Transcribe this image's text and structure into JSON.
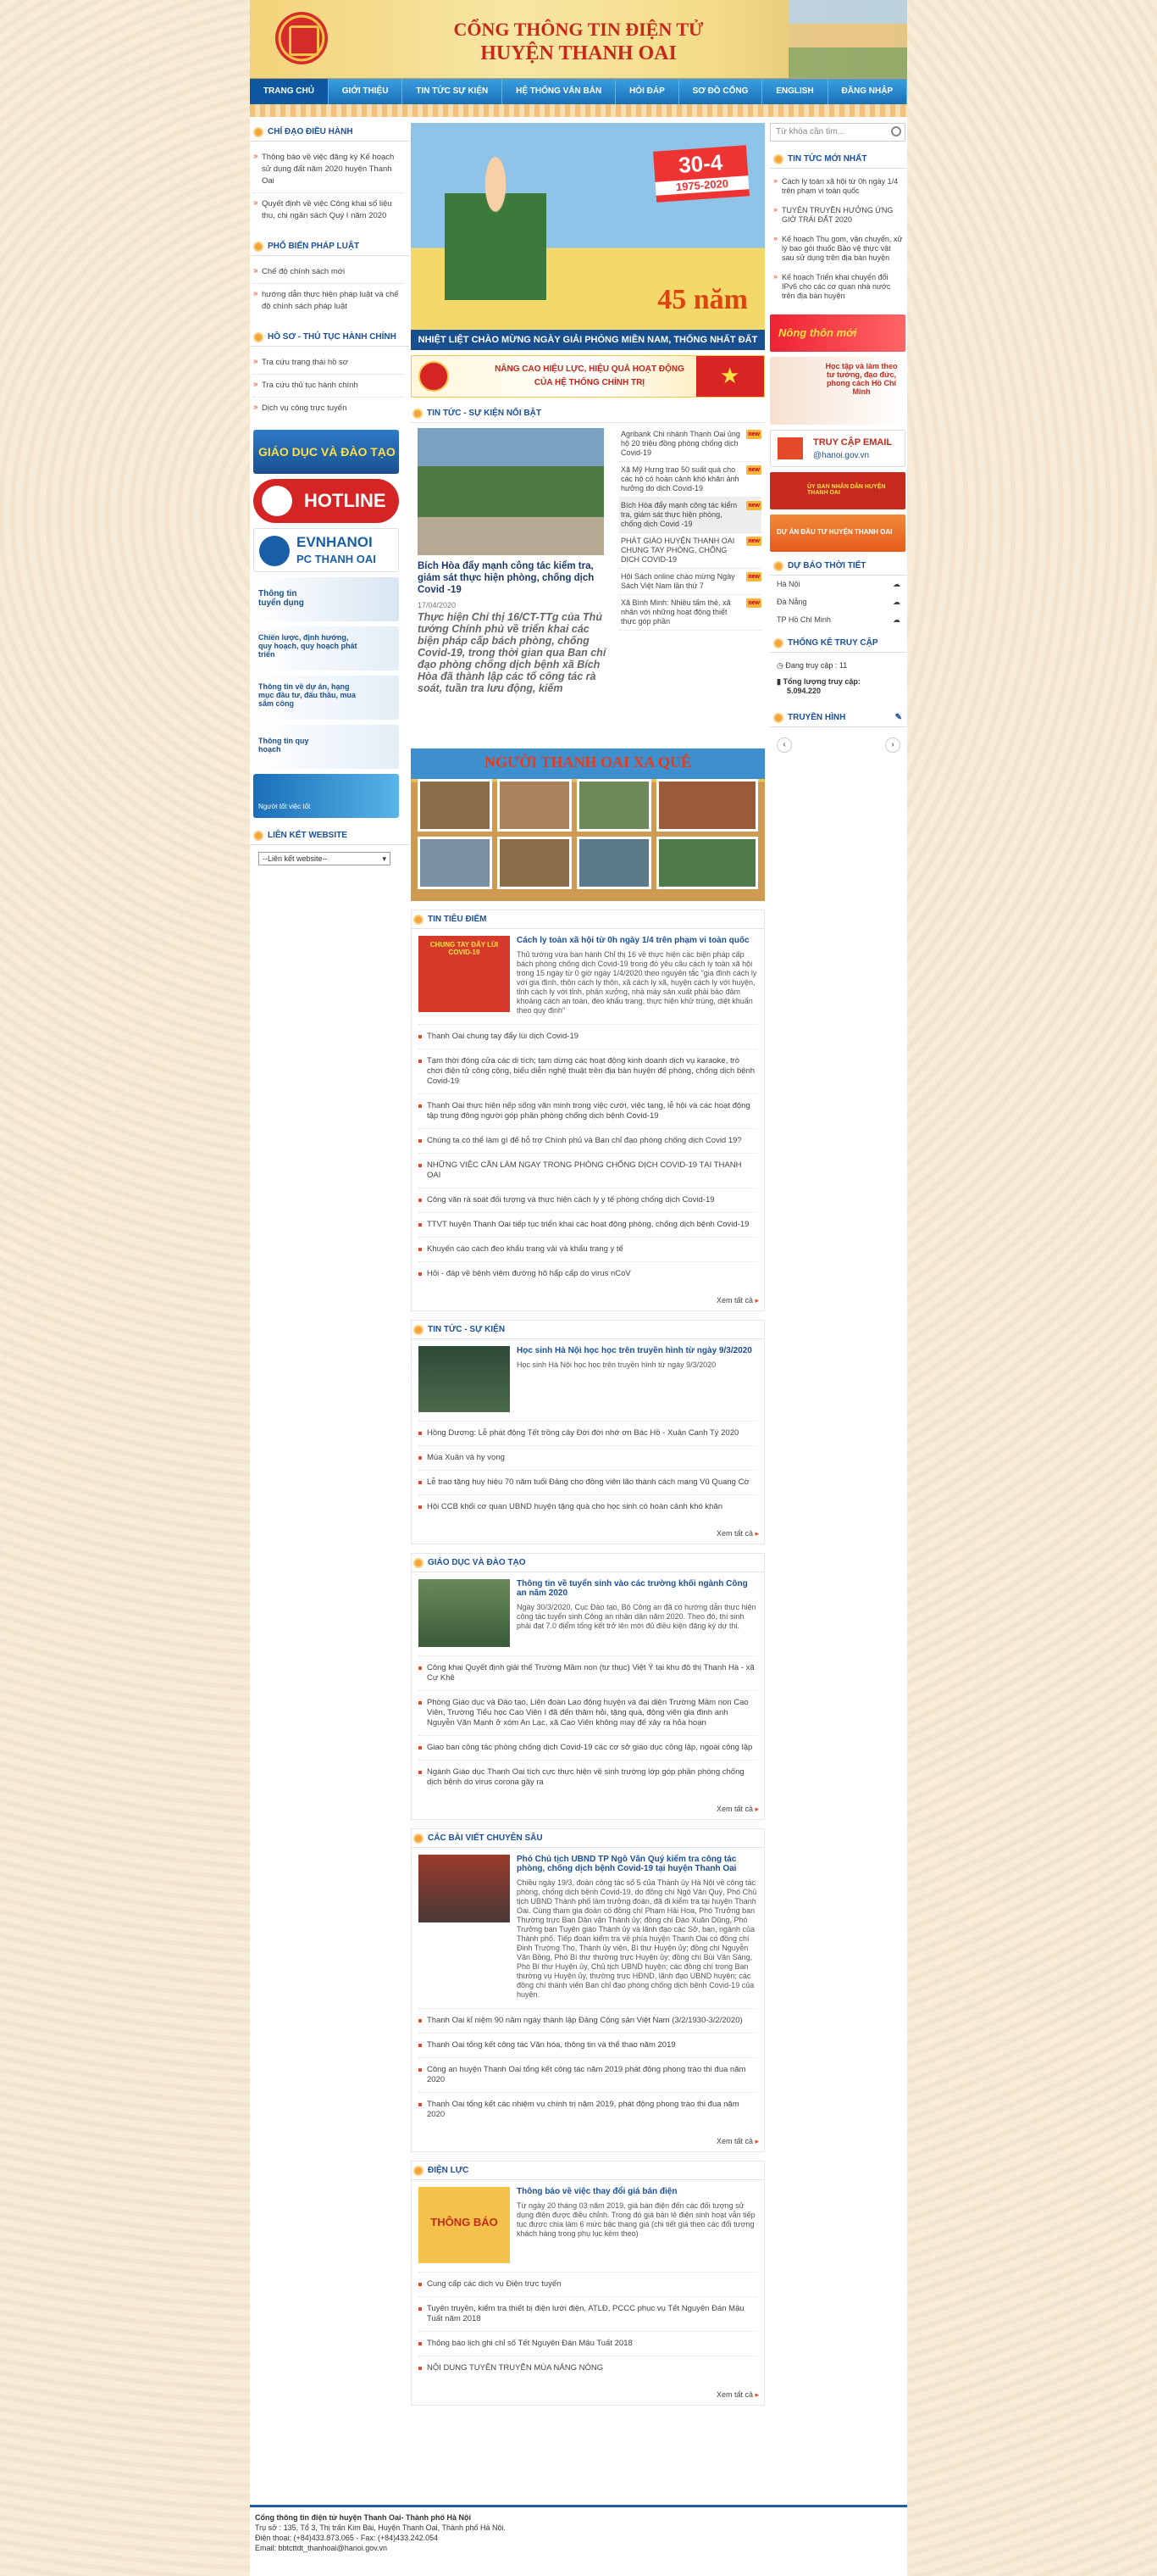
{
  "header": {
    "line1": "CỔNG THÔNG TIN ĐIỆN TỬ",
    "line2": "HUYỆN THANH OAI"
  },
  "menu": [
    "TRANG CHỦ",
    "GIỚI THIỆU",
    "TIN TỨC SỰ KIỆN",
    "HỆ THỐNG VĂN BẢN",
    "HỎI ĐÁP",
    "SƠ ĐỒ CỔNG",
    "ENGLISH",
    "ĐĂNG NHẬP"
  ],
  "left": {
    "chidao": {
      "title": "CHỈ ĐẠO ĐIỀU HÀNH",
      "items": [
        "Thông báo về việc đăng ký Kế hoạch sử dụng đất năm 2020 huyện Thanh Oai",
        "Quyết định về việc Công khai số liệu thu, chi ngân sách Quý I năm 2020"
      ]
    },
    "phobien": {
      "title": "PHỔ BIẾN PHÁP LUẬT",
      "items": [
        "Chế độ chính sách mới",
        "hướng dẫn thực hiện pháp luật và chế độ chính sách pháp luật"
      ]
    },
    "hoso": {
      "title": "HỒ SƠ - THỦ TỤC HÀNH CHÍNH",
      "items": [
        "Tra cứu trạng thái hồ sơ",
        "Tra cứu thủ tục hành chính",
        "Dịch vụ công trực tuyến"
      ]
    },
    "banners": {
      "giaoduc": "GIÁO DỤC VÀ ĐÀO TẠO",
      "hotline": "HOTLINE",
      "evn1": "EVNHANOI",
      "evn2": "PC THANH OAI",
      "tt1": "Thông tin tuyển dụng",
      "tt2": "Chiến lược, định hướng, quy hoạch, quy hoạch phát triển",
      "tt3": "Thông tin về dự án, hạng mục đầu tư, đấu thầu, mua sắm công",
      "tt4": "Thông tin quy hoạch",
      "tt5": "Người tốt việc tốt"
    },
    "lienket": {
      "title": "LIÊN KẾT WEBSITE",
      "select": "--Liên kết website--"
    }
  },
  "center": {
    "slide": {
      "date1": "30-4",
      "date2": "1975-2020",
      "nam": "45 năm",
      "caption": "NHIỆT LIỆT CHÀO MỪNG NGÀY GIẢI PHÓNG MIỀN NAM, THỐNG NHẤT ĐẤT NƯỚC"
    },
    "slogan": {
      "l1": "NÂNG CAO HIỆU LỰC, HIỆU QUẢ HOẠT ĐỘNG",
      "l2": "CỦA HỆ THỐNG CHÍNH TRỊ"
    },
    "tintuc_title": "TIN TỨC - SỰ KIỆN NỔI BẬT",
    "featured": {
      "title": "Bích Hòa đẩy mạnh công tác kiểm tra, giám sát thực hiện phòng, chống dịch Covid -19",
      "date": "17/04/2020",
      "summary": "Thực hiện Chỉ thị 16/CT-TTg của Thủ tướng Chính phủ về triển khai các biện pháp cấp bách phòng, chống Covid-19, trong thời gian qua Ban chỉ đạo phòng chống dịch bệnh xã Bích Hòa đã thành lập các tổ công tác rà soát, tuần tra lưu động, kiểm"
    },
    "featured_list": [
      "Agribank Chi nhánh Thanh Oai ủng hộ 20 triệu đồng phòng chống dịch Covid-19",
      "Xã Mỹ Hưng trao 50 suất quà cho các hộ có hoàn cảnh khó khăn ảnh hưởng do dịch Covid-19",
      "Bích Hòa đẩy mạnh công tác kiểm tra, giám sát thực hiện phòng, chống dịch Covid -19",
      "PHÁT GIÁO HUYỆN THANH OAI CHUNG TAY PHÒNG, CHỐNG DỊCH COVID-19",
      "Hội Sách online chào mừng Ngày Sách Việt Nam lần thứ 7",
      "Xã Bình Minh: Nhiều tấm thẻ, xã nhân với những hoạt động thiết thực góp phần"
    ],
    "new_badge": "new",
    "ntox": "NGƯỜI THANH OAI XA QUÊ",
    "sections": [
      {
        "title": "TIN TIÊU ĐIỂM",
        "top_title": "Cách ly toàn xã hội từ 0h ngày 1/4 trên phạm vi toàn quốc",
        "top_text": "Thủ tướng vừa ban hành Chỉ thị 16 về thực hiện các biện pháp cấp bách phòng chống dịch Covid-19 trong đó yêu cầu cách ly toàn xã hội trong 15 ngày từ 0 giờ ngày 1/4/2020 theo nguyên tắc \"gia đình cách ly với gia đình, thôn cách ly thôn, xã cách ly xã, huyện cách ly với huyện, tỉnh cách ly với tỉnh, phân xưởng, nhà máy sản xuất phải bảo đảm khoảng cách an toàn, đeo khẩu trang, thực hiện khử trùng, diệt khuẩn theo quy định\"",
        "img_text": "CHUNG TAY ĐẨY LÙI COVID-19",
        "items": [
          "Thanh Oai chung tay đẩy lùi dịch Covid-19",
          "Tạm thời đóng cửa các di tích; tạm dừng các hoạt động kinh doanh dịch vụ karaoke, trò chơi điện tử công cộng, biểu diễn nghệ thuật trên địa bàn huyện để phòng, chống dịch bệnh Covid-19",
          "Thanh Oai thực hiện nếp sống văn minh trong việc cưới, việc tang, lễ hội và các hoạt động tập trung đông người góp phần phòng chống dịch bệnh Covid-19",
          "Chúng ta có thể làm gì để hỗ trợ Chính phủ và Ban chỉ đạo phòng chống dịch Covid 19?",
          "NHỮNG VIỆC CẦN LÀM NGAY TRONG PHÒNG CHỐNG DỊCH COVID-19 TẠI THANH OAI",
          "Công văn rà soát đối tượng và thực hiện cách ly y tế phòng chống dịch Covid-19",
          "TTVT huyện Thanh Oai tiếp tục triển khai các hoạt động phòng, chống dịch bệnh Covid-19",
          "Khuyến cáo cách đeo khẩu trang vải và khẩu trang y tế",
          "Hỏi - đáp về bệnh viêm đường hô hấp cấp do virus nCoV"
        ]
      },
      {
        "title": "TIN TỨC - SỰ KIỆN",
        "top_title": "Học sinh Hà Nội học học trên truyền hình từ ngày 9/3/2020",
        "top_text": "Học sinh Hà Nội học học trên truyền hình từ ngày 9/3/2020",
        "items": [
          "Hồng Dương: Lễ phát động Tết trồng cây Đời đời nhớ ơn Bác Hồ - Xuân Canh Tý 2020",
          "Mùa Xuân và hy vọng",
          "Lễ trao tặng huy hiệu 70 năm tuổi Đảng cho đồng viên lão thành cách mạng Vũ Quang Cờ",
          "Hội CCB khối cơ quan UBND huyện tặng quà cho học sinh có hoàn cảnh khó khăn"
        ]
      },
      {
        "title": "GIÁO DỤC VÀ ĐÀO TẠO",
        "top_title": "Thông tin về tuyển sinh vào các trường khối ngành Công an năm 2020",
        "top_text": "Ngày 30/3/2020, Cục Đào tạo, Bộ Công an đã có hướng dẫn thực hiện công tác tuyển sinh Công an nhân dân năm 2020. Theo đó, thí sinh phải đạt 7.0 điểm tổng kết trở lên mới đủ điều kiện đăng ký dự thi.",
        "items": [
          "Công khai Quyết định giải thể Trường Mầm non (tư thục) Việt Ý tại khu đô thị Thanh Hà - xã Cự Khê",
          "Phòng Giáo dục và Đào tạo, Liên đoàn Lao động huyện và đại diện Trường Mầm non Cao Viên, Trường Tiểu học Cao Viên I đã đến thăm hỏi, tặng quà, động viên gia đình anh Nguyễn Văn Mạnh ở xóm An Lạc, xã Cao Viên không may để xảy ra hỏa hoạn",
          "Giao ban công tác phòng chống dịch Covid-19 các cơ sở giáo dục công lập, ngoài công lập",
          "Ngành Giáo dục Thanh Oai tích cực thực hiện về sinh trường lớp góp phần phòng chống dịch bệnh do virus corona gây ra"
        ]
      },
      {
        "title": "CÁC BÀI VIẾT CHUYÊN SÂU",
        "top_title": "Phó Chủ tịch UBND TP Ngô Văn Quý kiểm tra công tác phòng, chống dịch bệnh Covid-19 tại huyện Thanh Oai",
        "top_text": "Chiều ngày 19/3, đoàn công tác số 5 của Thành ủy Hà Nội về công tác phòng, chống dịch bệnh Covid-19, do đồng chí Ngô Văn Quý, Phó Chủ tịch UBND Thành phố làm trưởng đoàn, đã đi kiểm tra tại huyện Thanh Oai. Cùng tham gia đoàn có đồng chí Phạm Hải Hoa, Phó Trưởng ban Thường trực Ban Dân vận Thành ủy; đồng chí Đào Xuân Dũng, Phó Trưởng ban Tuyên giáo Thành ủy và lãnh đạo các Sở, ban, ngành của Thành phố. Tiếp đoàn kiểm tra về phía huyện Thanh Oai có đồng chí Đinh Trường Thọ, Thành ủy viên, Bí thư Huyện ủy; đồng chí Nguyễn Văn Bồng, Phó Bí thư thường trực Huyện ủy; đồng chí Bùi Văn Sáng, Phó Bí thư Huyện ủy, Chủ tịch UBND huyện; các đồng chí trong Ban thường vụ Huyện ủy, thường trực HĐND, lãnh đạo UBND huyện; các đồng chí thành viên Ban chỉ đạo phòng chống dịch bệnh Covid-19 của huyện.",
        "items": [
          "Thanh Oai kỉ niệm 90 năm ngày thành lập Đảng Cộng sản Việt Nam (3/2/1930-3/2/2020)",
          "Thanh Oai tổng kết công tác Văn hóa, thông tin và thể thao năm 2019",
          "Công an huyện Thanh Oai tổng kết công tác năm 2019 phát động phong trào thi đua năm 2020",
          "Thanh Oai tổng kết các nhiệm vụ chính trị năm 2019, phát động phong trào thi đua năm 2020"
        ]
      },
      {
        "title": "ĐIỆN LỰC",
        "top_title": "Thông báo về việc thay đổi giá bán điện",
        "top_text": "Từ ngày 20 tháng 03 năm 2019, giá bán điện đến các đối tượng sử dụng điện được điều chỉnh. Trong đó giá bán lẻ điện sinh hoạt vẫn tiếp tục được chia làm 6 mức bậc thang giá (chi tiết giá theo các đối tượng khách hàng trong phụ lục kèm theo)",
        "img_text": "THÔNG BÁO",
        "items": [
          "Cung cấp các dịch vụ Điện trực tuyến",
          "Tuyên truyền, kiểm tra thiết bị điện lưới điện, ATLĐ, PCCC phục vụ Tết Nguyên Đán Mậu Tuất năm 2018",
          "Thông báo lịch ghi chỉ số Tết Nguyên Đán Mậu Tuất 2018",
          "NỘI DUNG TUYÊN TRUYỀN MÙA NẮNG NÓNG"
        ]
      }
    ],
    "more": "Xem tất cả"
  },
  "right": {
    "search_placeholder": "Từ khóa cần tìm...",
    "moinhat": {
      "title": "TIN TỨC MỚI NHẤT",
      "items": [
        "Cách ly toàn xã hội từ 0h ngày 1/4 trên phạm vi toàn quốc",
        "TUYÊN TRUYỀN HƯỞNG ỨNG GIỜ TRÁI ĐẤT 2020",
        "Kế hoạch Thu gom, vận chuyển, xử lý bao gói thuốc Bảo vệ thực vật sau sử dụng trên địa bàn huyện",
        "Kế hoạch Triển khai chuyển đổi IPv6 cho các cơ quan nhà nước trên địa bàn huyện"
      ]
    },
    "banners": {
      "b1": "Nông thôn mới",
      "b2": "Học tập và làm theo tư tưởng, đạo đức, phong cách Hồ Chí Minh",
      "b3": "TRUY CẬP EMAIL",
      "b3s": "@hanoi.gov.vn",
      "b4": "ỦY BAN NHÂN DÂN HUYỆN THANH OAI",
      "b5": "DỰ ÁN ĐẦU TƯ HUYỆN THANH OAI"
    },
    "thoitiet": {
      "title": "DỰ BÁO THỜI TIẾT",
      "items": [
        "Hà Nội",
        "Đà Nẵng",
        "TP Hồ Chí Minh"
      ]
    },
    "thongke": {
      "title": "THỐNG KÊ TRUY CẬP",
      "dang_label": "Đang truy cập :",
      "dang_value": "11",
      "tong_label": "Tổng lượng truy cập:",
      "tong_value": "5.094.220"
    },
    "truyenhinh": {
      "title": "TRUYỀN HÌNH"
    }
  },
  "footer": {
    "title": "Cổng thông tin điện tử huyện Thanh Oai- Thành phố Hà Nội",
    "addr": "Trụ sở : 135, Tổ 3, Thị trấn Kim Bài, Huyện Thanh Oai, Thành phố Hà Nội.",
    "phone": "Điện thoại: (+84)433.873.065 - Fax: (+84)433.242.054",
    "email": "Email: bbtcttdt_thanhoai@hanoi.gov.vn"
  },
  "colors": {
    "menu": "#1a6fb8",
    "brand_red": "#c52a1c",
    "heading": "#1b4f9b"
  }
}
